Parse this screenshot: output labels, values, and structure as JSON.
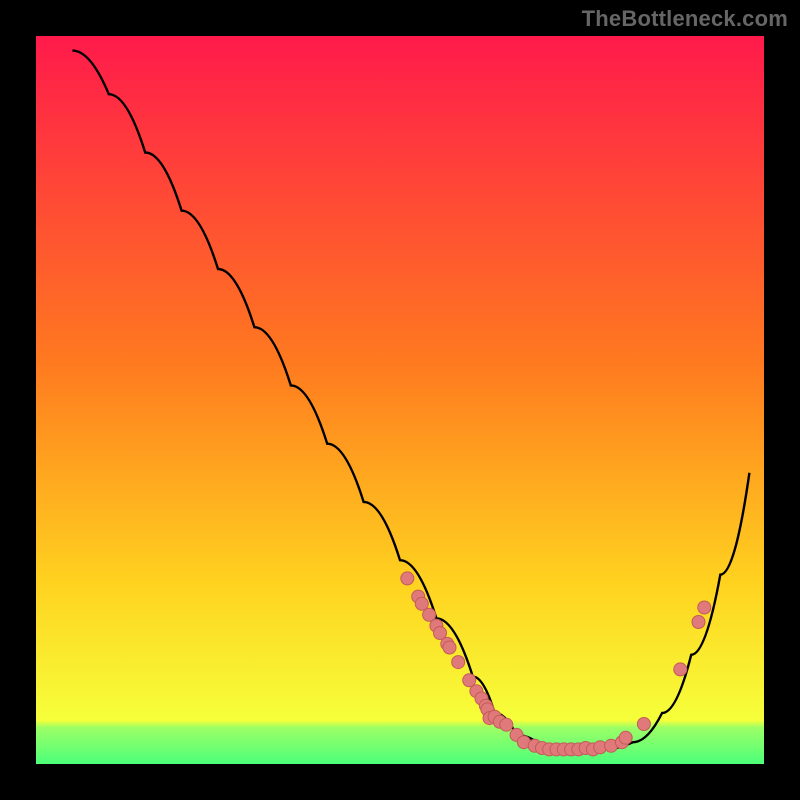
{
  "watermark": "TheBottleneck.com",
  "colors": {
    "gradient_top": "#ff1a4b",
    "gradient_mid": "#ffd21f",
    "gradient_bottom_band": "#4cff7a",
    "curve": "#000000",
    "marker_fill": "#e07a7a",
    "marker_stroke": "#c45a5a"
  },
  "chart_data": {
    "type": "line",
    "title": "",
    "xlabel": "",
    "ylabel": "",
    "xlim": [
      0,
      100
    ],
    "ylim": [
      0,
      100
    ],
    "series": [
      {
        "name": "bottleneck-curve",
        "x": [
          5,
          10,
          15,
          20,
          25,
          30,
          35,
          40,
          45,
          50,
          55,
          60,
          63,
          66,
          70,
          74,
          78,
          82,
          86,
          90,
          94,
          98
        ],
        "y": [
          98,
          92,
          84,
          76,
          68,
          60,
          52,
          44,
          36,
          28,
          20,
          12,
          7,
          4,
          2,
          2,
          2,
          3,
          7,
          15,
          26,
          40
        ]
      }
    ],
    "markers": [
      {
        "x": 51.0,
        "y": 25.5
      },
      {
        "x": 52.5,
        "y": 23.0
      },
      {
        "x": 53.0,
        "y": 22.0
      },
      {
        "x": 54.0,
        "y": 20.5
      },
      {
        "x": 55.0,
        "y": 19.0
      },
      {
        "x": 55.5,
        "y": 18.0
      },
      {
        "x": 56.5,
        "y": 16.5
      },
      {
        "x": 56.8,
        "y": 16.0
      },
      {
        "x": 58.0,
        "y": 14.0
      },
      {
        "x": 59.5,
        "y": 11.5
      },
      {
        "x": 60.5,
        "y": 10.0
      },
      {
        "x": 61.2,
        "y": 9.0
      },
      {
        "x": 61.8,
        "y": 8.0
      },
      {
        "x": 62.0,
        "y": 7.5
      },
      {
        "x": 62.3,
        "y": 6.3
      },
      {
        "x": 63.0,
        "y": 6.5
      },
      {
        "x": 63.7,
        "y": 5.8
      },
      {
        "x": 64.6,
        "y": 5.4
      },
      {
        "x": 66.0,
        "y": 4.0
      },
      {
        "x": 67.0,
        "y": 3.0
      },
      {
        "x": 68.5,
        "y": 2.5
      },
      {
        "x": 69.5,
        "y": 2.2
      },
      {
        "x": 70.5,
        "y": 2.0
      },
      {
        "x": 71.5,
        "y": 2.0
      },
      {
        "x": 72.5,
        "y": 2.0
      },
      {
        "x": 73.5,
        "y": 2.0
      },
      {
        "x": 74.5,
        "y": 2.0
      },
      {
        "x": 75.5,
        "y": 2.2
      },
      {
        "x": 76.5,
        "y": 2.0
      },
      {
        "x": 77.5,
        "y": 2.3
      },
      {
        "x": 79.0,
        "y": 2.5
      },
      {
        "x": 80.5,
        "y": 3.0
      },
      {
        "x": 81.0,
        "y": 3.6
      },
      {
        "x": 83.5,
        "y": 5.5
      },
      {
        "x": 88.5,
        "y": 13.0
      },
      {
        "x": 91.0,
        "y": 19.5
      },
      {
        "x": 91.8,
        "y": 21.5
      }
    ]
  }
}
